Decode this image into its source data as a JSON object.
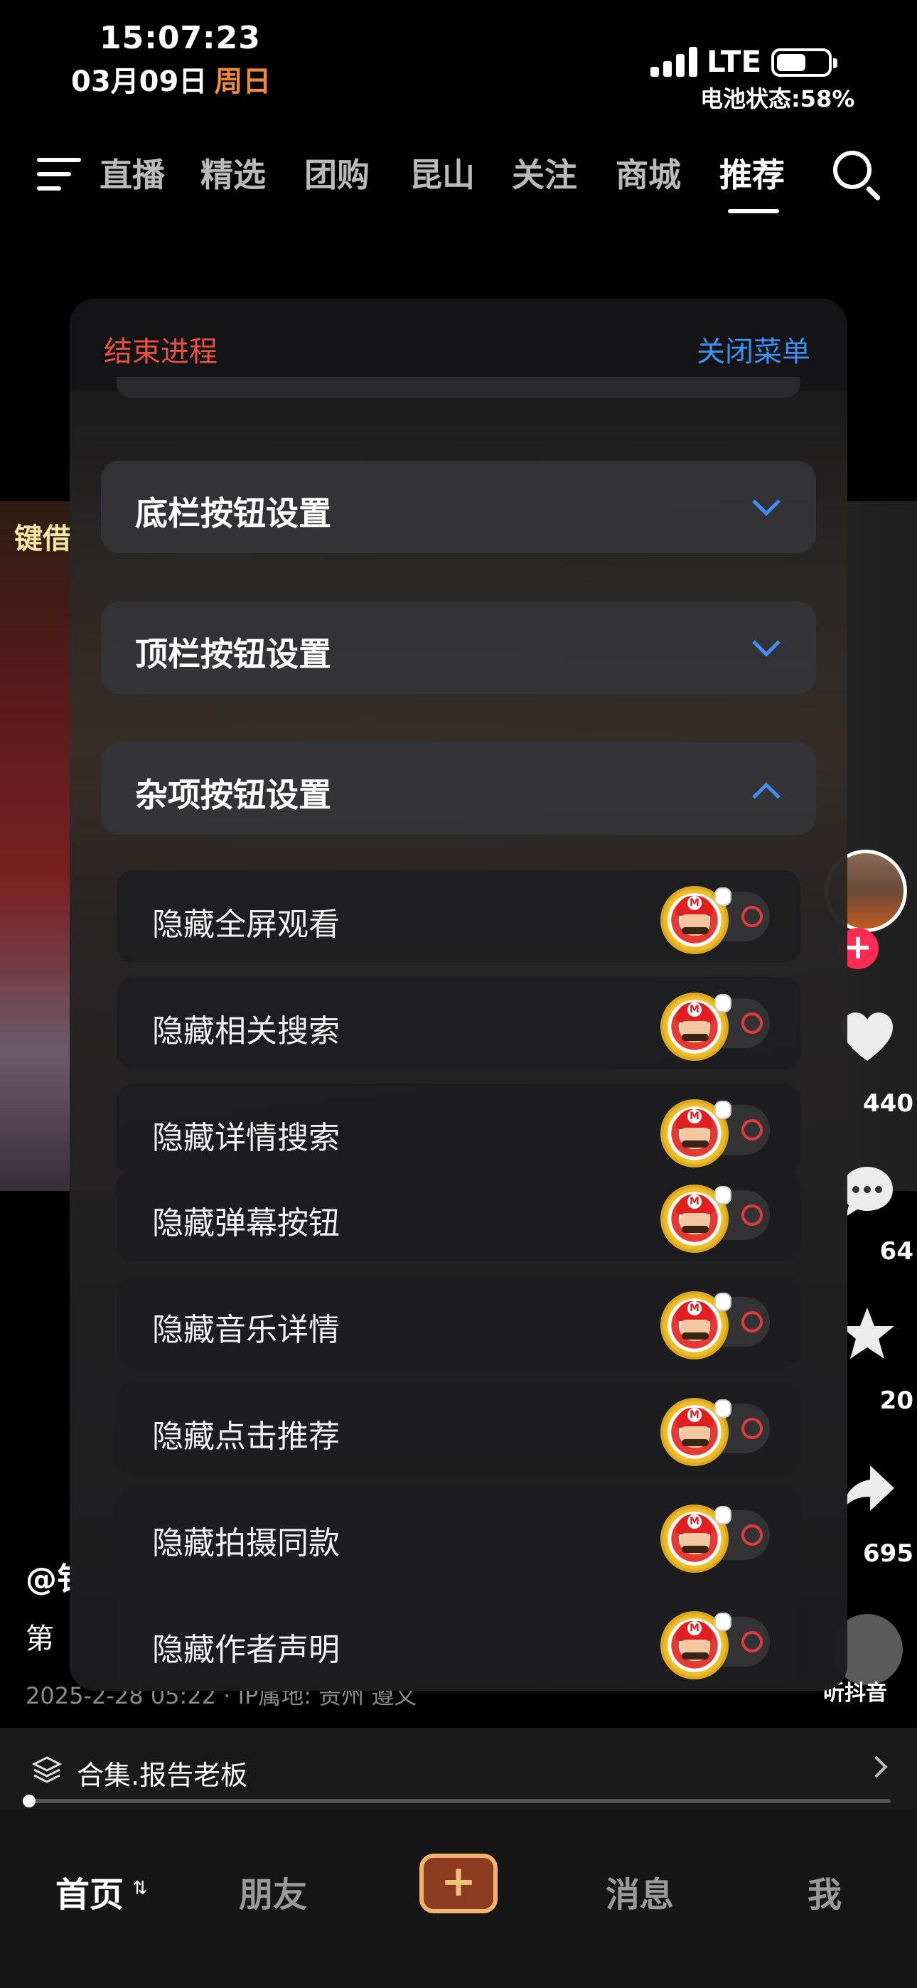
{
  "status_bar": {
    "time": "15:07:23",
    "date": "03月09日",
    "weekday": "周日",
    "network": "LTE",
    "battery_text": "电池状态:58%",
    "battery_level": 0.58
  },
  "top_nav": {
    "tabs": [
      "直播",
      "精选",
      "团购",
      "昆山",
      "关注",
      "商城",
      "推荐"
    ],
    "active_tab": "推荐"
  },
  "video": {
    "overlay_text": "键借",
    "author": "@钅",
    "desc": "第",
    "meta": "2025-2-28 05:22 · IP属地: 贵州 遵义",
    "counts": {
      "likes": "440",
      "comments": "64",
      "favorites": "20",
      "shares": "695"
    },
    "listen_label": "听抖音"
  },
  "menu": {
    "end_process": "结束进程",
    "close_menu": "关闭菜单",
    "sections": [
      {
        "title": "底栏按钮设置",
        "expanded": false
      },
      {
        "title": "顶栏按钮设置",
        "expanded": false
      },
      {
        "title": "杂项按钮设置",
        "expanded": true
      }
    ],
    "items": [
      {
        "label": "隐藏全屏观看",
        "on": false
      },
      {
        "label": "隐藏相关搜索",
        "on": false
      },
      {
        "label": "隐藏详情搜索",
        "on": false
      },
      {
        "label": "隐藏弹幕按钮",
        "on": false
      },
      {
        "label": "隐藏音乐详情",
        "on": false
      },
      {
        "label": "隐藏点击推荐",
        "on": false
      },
      {
        "label": "隐藏拍摄同款",
        "on": false
      },
      {
        "label": "隐藏作者声明",
        "on": false
      }
    ],
    "accent_color": "#3f8ef0",
    "danger_color": "#e8523f"
  },
  "collection": {
    "label": "合集.报告老板"
  },
  "bottom_bar": {
    "home": "首页",
    "friends": "朋友",
    "plus": "+",
    "messages": "消息",
    "me": "我"
  }
}
